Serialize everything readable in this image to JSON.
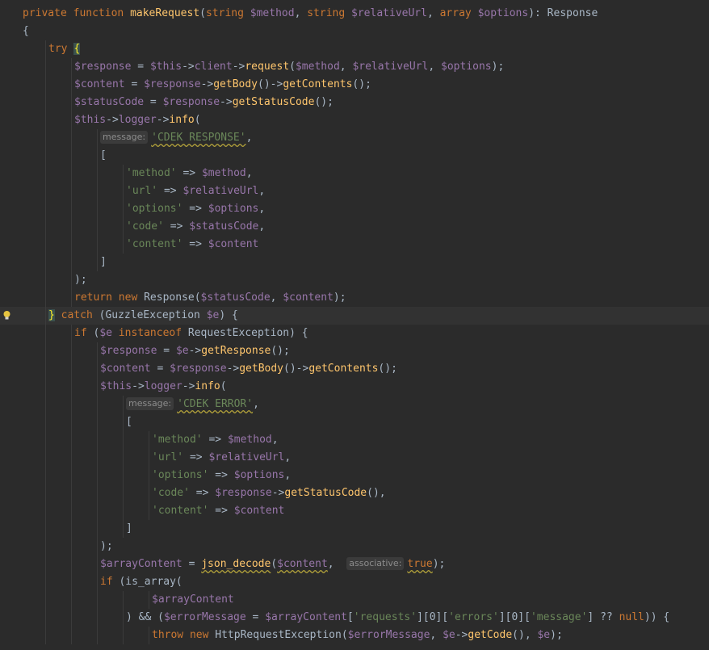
{
  "colors": {
    "background": "#2b2b2b",
    "current_line": "#323232",
    "keyword": "#cc7832",
    "function": "#ffc66d",
    "variable": "#9876aa",
    "string": "#6a8759",
    "plain": "#a9b7c6",
    "hint_bg": "#3b3b3b",
    "hint_text": "#8c8c8c"
  },
  "editor": {
    "current_line_index": 17,
    "lines": [
      {
        "indent": 0,
        "tokens": [
          [
            "kw",
            "private function "
          ],
          [
            "fn",
            "makeRequest"
          ],
          [
            "plain",
            "("
          ],
          [
            "kw",
            "string "
          ],
          [
            "var",
            "$method"
          ],
          [
            "plain",
            ", "
          ],
          [
            "kw",
            "string "
          ],
          [
            "var",
            "$relativeUrl"
          ],
          [
            "plain",
            ", "
          ],
          [
            "kw",
            "array "
          ],
          [
            "var",
            "$options"
          ],
          [
            "plain",
            "): Response"
          ]
        ]
      },
      {
        "indent": 0,
        "tokens": [
          [
            "plain",
            "{"
          ]
        ]
      },
      {
        "indent": 1,
        "tokens": [
          [
            "kw",
            "try "
          ],
          [
            "brace-hl",
            "{"
          ]
        ]
      },
      {
        "indent": 2,
        "tokens": [
          [
            "var",
            "$response"
          ],
          [
            "plain",
            " = "
          ],
          [
            "var",
            "$this"
          ],
          [
            "plain",
            "->"
          ],
          [
            "var",
            "client"
          ],
          [
            "plain",
            "->"
          ],
          [
            "fn",
            "request"
          ],
          [
            "plain",
            "("
          ],
          [
            "var",
            "$method"
          ],
          [
            "plain",
            ", "
          ],
          [
            "var",
            "$relativeUrl"
          ],
          [
            "plain",
            ", "
          ],
          [
            "var",
            "$options"
          ],
          [
            "plain",
            ");"
          ]
        ]
      },
      {
        "indent": 2,
        "tokens": [
          [
            "var",
            "$content"
          ],
          [
            "plain",
            " = "
          ],
          [
            "var",
            "$response"
          ],
          [
            "plain",
            "->"
          ],
          [
            "fn",
            "getBody"
          ],
          [
            "plain",
            "()->"
          ],
          [
            "fn",
            "getContents"
          ],
          [
            "plain",
            "();"
          ]
        ]
      },
      {
        "indent": 2,
        "tokens": [
          [
            "var",
            "$statusCode"
          ],
          [
            "plain",
            " = "
          ],
          [
            "var",
            "$response"
          ],
          [
            "plain",
            "->"
          ],
          [
            "fn",
            "getStatusCode"
          ],
          [
            "plain",
            "();"
          ]
        ]
      },
      {
        "indent": 2,
        "tokens": [
          [
            "var",
            "$this"
          ],
          [
            "plain",
            "->"
          ],
          [
            "var",
            "logger"
          ],
          [
            "plain",
            "->"
          ],
          [
            "fn",
            "info"
          ],
          [
            "plain",
            "("
          ]
        ]
      },
      {
        "indent": 3,
        "tokens": [
          [
            "hint",
            "message:"
          ],
          [
            "str-wavy",
            "'CDEK RESPONSE'"
          ],
          [
            "plain",
            ","
          ]
        ]
      },
      {
        "indent": 3,
        "tokens": [
          [
            "plain",
            "["
          ]
        ]
      },
      {
        "indent": 4,
        "tokens": [
          [
            "str",
            "'method'"
          ],
          [
            "plain",
            " => "
          ],
          [
            "var",
            "$method"
          ],
          [
            "plain",
            ","
          ]
        ]
      },
      {
        "indent": 4,
        "tokens": [
          [
            "str",
            "'url'"
          ],
          [
            "plain",
            " => "
          ],
          [
            "var",
            "$relativeUrl"
          ],
          [
            "plain",
            ","
          ]
        ]
      },
      {
        "indent": 4,
        "tokens": [
          [
            "str",
            "'options'"
          ],
          [
            "plain",
            " => "
          ],
          [
            "var",
            "$options"
          ],
          [
            "plain",
            ","
          ]
        ]
      },
      {
        "indent": 4,
        "tokens": [
          [
            "str",
            "'code'"
          ],
          [
            "plain",
            " => "
          ],
          [
            "var",
            "$statusCode"
          ],
          [
            "plain",
            ","
          ]
        ]
      },
      {
        "indent": 4,
        "tokens": [
          [
            "str",
            "'content'"
          ],
          [
            "plain",
            " => "
          ],
          [
            "var",
            "$content"
          ]
        ]
      },
      {
        "indent": 3,
        "tokens": [
          [
            "plain",
            "]"
          ]
        ]
      },
      {
        "indent": 2,
        "tokens": [
          [
            "plain",
            ");"
          ]
        ]
      },
      {
        "indent": 2,
        "tokens": [
          [
            "kw",
            "return new "
          ],
          [
            "plain",
            "Response("
          ],
          [
            "var",
            "$statusCode"
          ],
          [
            "plain",
            ", "
          ],
          [
            "var",
            "$content"
          ],
          [
            "plain",
            ");"
          ]
        ]
      },
      {
        "indent": 1,
        "tokens": [
          [
            "brace-hl",
            "}"
          ],
          [
            "kw",
            " catch "
          ],
          [
            "plain",
            "(GuzzleException "
          ],
          [
            "var",
            "$e"
          ],
          [
            "plain",
            ") {"
          ]
        ]
      },
      {
        "indent": 2,
        "tokens": [
          [
            "kw",
            "if "
          ],
          [
            "plain",
            "("
          ],
          [
            "var",
            "$e"
          ],
          [
            "kw",
            " instanceof "
          ],
          [
            "plain",
            "RequestException) {"
          ]
        ]
      },
      {
        "indent": 3,
        "tokens": [
          [
            "var",
            "$response"
          ],
          [
            "plain",
            " = "
          ],
          [
            "var",
            "$e"
          ],
          [
            "plain",
            "->"
          ],
          [
            "fn",
            "getResponse"
          ],
          [
            "plain",
            "();"
          ]
        ]
      },
      {
        "indent": 3,
        "tokens": [
          [
            "var",
            "$content"
          ],
          [
            "plain",
            " = "
          ],
          [
            "var",
            "$response"
          ],
          [
            "plain",
            "->"
          ],
          [
            "fn",
            "getBody"
          ],
          [
            "plain",
            "()->"
          ],
          [
            "fn",
            "getContents"
          ],
          [
            "plain",
            "();"
          ]
        ]
      },
      {
        "indent": 3,
        "tokens": [
          [
            "var",
            "$this"
          ],
          [
            "plain",
            "->"
          ],
          [
            "var",
            "logger"
          ],
          [
            "plain",
            "->"
          ],
          [
            "fn",
            "info"
          ],
          [
            "plain",
            "("
          ]
        ]
      },
      {
        "indent": 4,
        "tokens": [
          [
            "hint",
            "message:"
          ],
          [
            "str-wavy",
            "'CDEK ERROR'"
          ],
          [
            "plain",
            ","
          ]
        ]
      },
      {
        "indent": 4,
        "tokens": [
          [
            "plain",
            "["
          ]
        ]
      },
      {
        "indent": 5,
        "tokens": [
          [
            "str",
            "'method'"
          ],
          [
            "plain",
            " => "
          ],
          [
            "var",
            "$method"
          ],
          [
            "plain",
            ","
          ]
        ]
      },
      {
        "indent": 5,
        "tokens": [
          [
            "str",
            "'url'"
          ],
          [
            "plain",
            " => "
          ],
          [
            "var",
            "$relativeUrl"
          ],
          [
            "plain",
            ","
          ]
        ]
      },
      {
        "indent": 5,
        "tokens": [
          [
            "str",
            "'options'"
          ],
          [
            "plain",
            " => "
          ],
          [
            "var",
            "$options"
          ],
          [
            "plain",
            ","
          ]
        ]
      },
      {
        "indent": 5,
        "tokens": [
          [
            "str",
            "'code'"
          ],
          [
            "plain",
            " => "
          ],
          [
            "var",
            "$response"
          ],
          [
            "plain",
            "->"
          ],
          [
            "fn",
            "getStatusCode"
          ],
          [
            "plain",
            "(),"
          ]
        ]
      },
      {
        "indent": 5,
        "tokens": [
          [
            "str",
            "'content'"
          ],
          [
            "plain",
            " => "
          ],
          [
            "var",
            "$content"
          ]
        ]
      },
      {
        "indent": 4,
        "tokens": [
          [
            "plain",
            "]"
          ]
        ]
      },
      {
        "indent": 3,
        "tokens": [
          [
            "plain",
            ");"
          ]
        ]
      },
      {
        "indent": 3,
        "tokens": [
          [
            "var",
            "$arrayContent"
          ],
          [
            "plain",
            " = "
          ],
          [
            "fn-wavy",
            "json_decode"
          ],
          [
            "plain",
            "("
          ],
          [
            "var-wavy",
            "$content"
          ],
          [
            "plain",
            ",  "
          ],
          [
            "hint",
            "associative:"
          ],
          [
            "kw-wavy",
            "true"
          ],
          [
            "plain",
            ");"
          ]
        ]
      },
      {
        "indent": 3,
        "tokens": [
          [
            "kw",
            "if "
          ],
          [
            "plain",
            "(is_array("
          ]
        ]
      },
      {
        "indent": 5,
        "tokens": [
          [
            "var",
            "$arrayContent"
          ]
        ]
      },
      {
        "indent": 4,
        "tokens": [
          [
            "plain",
            ") && ("
          ],
          [
            "var",
            "$errorMessage"
          ],
          [
            "plain",
            " = "
          ],
          [
            "var",
            "$arrayContent"
          ],
          [
            "plain",
            "["
          ],
          [
            "str",
            "'requests'"
          ],
          [
            "plain",
            "]["
          ],
          [
            "plain",
            "0"
          ],
          [
            "plain",
            "]["
          ],
          [
            "str",
            "'errors'"
          ],
          [
            "plain",
            "]["
          ],
          [
            "plain",
            "0"
          ],
          [
            "plain",
            "]["
          ],
          [
            "str",
            "'message'"
          ],
          [
            "plain",
            "] ?? "
          ],
          [
            "kw",
            "null"
          ],
          [
            "plain",
            ")) {"
          ]
        ]
      },
      {
        "indent": 5,
        "tokens": [
          [
            "kw",
            "throw new "
          ],
          [
            "plain",
            "HttpRequestException("
          ],
          [
            "var",
            "$errorMessage"
          ],
          [
            "plain",
            ", "
          ],
          [
            "var",
            "$e"
          ],
          [
            "plain",
            "->"
          ],
          [
            "fn",
            "getCode"
          ],
          [
            "plain",
            "(), "
          ],
          [
            "var",
            "$e"
          ],
          [
            "plain",
            ");"
          ]
        ]
      }
    ]
  }
}
